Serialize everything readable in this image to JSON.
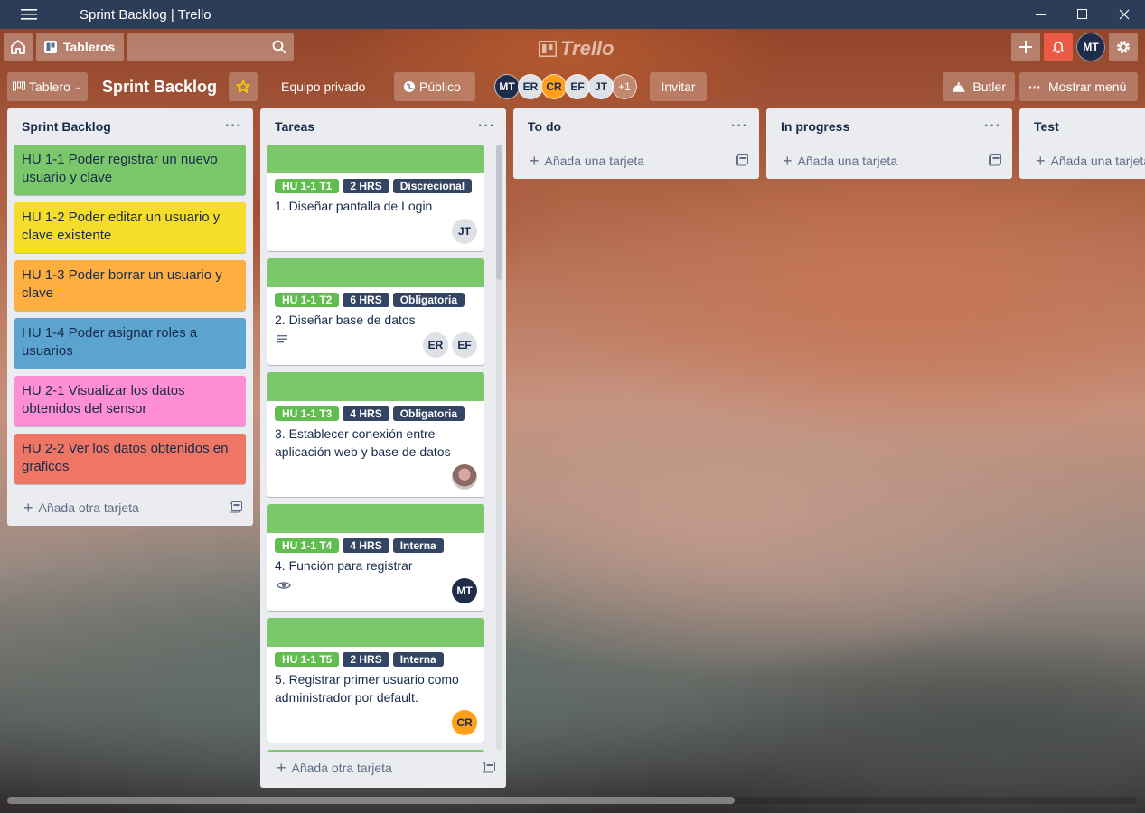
{
  "window": {
    "title": "Sprint Backlog | Trello"
  },
  "header": {
    "boards_label": "Tableros",
    "logo_text": "Trello",
    "user_initials": "MT"
  },
  "board": {
    "view_label": "Tablero",
    "title": "Sprint Backlog",
    "team_label": "Equipo privado",
    "visibility_label": "Público",
    "members": [
      "MT",
      "ER",
      "CR",
      "EF",
      "JT"
    ],
    "members_more": "+1",
    "invite_label": "Invitar",
    "butler_label": "Butler",
    "menu_label": "Mostrar menú"
  },
  "lists": [
    {
      "name": "Sprint Backlog",
      "add_label": "Añada otra tarjeta",
      "cards": [
        {
          "title": "HU 1-1 Poder registrar un nuevo usuario y clave",
          "color": "#7bc86c"
        },
        {
          "title": "HU 1-2 Poder editar un usuario y clave existente",
          "color": "#f5dd29"
        },
        {
          "title": "HU 1-3 Poder borrar un usuario y clave",
          "color": "#ffaf3f"
        },
        {
          "title": "HU 1-4 Poder asignar roles a usuarios",
          "color": "#5ba4cf"
        },
        {
          "title": "HU 2-1 Visualizar los datos obtenidos del sensor",
          "color": "#ff8ed4"
        },
        {
          "title": "HU 2-2 Ver los datos obtenidos en graficos",
          "color": "#ef7564"
        }
      ]
    },
    {
      "name": "Tareas",
      "add_label": "Añada otra tarjeta",
      "cards": [
        {
          "labels": [
            "HU 1-1 T1",
            "2 HRS",
            "Discrecional"
          ],
          "title": "1. Diseñar pantalla de Login",
          "members": [
            "JT"
          ]
        },
        {
          "labels": [
            "HU 1-1 T2",
            "6 HRS",
            "Obligatoria"
          ],
          "title": "2. Diseñar base de datos",
          "members": [
            "ER",
            "EF"
          ],
          "badge": "description-icon"
        },
        {
          "labels": [
            "HU 1-1 T3",
            "4 HRS",
            "Obligatoria"
          ],
          "title": "3. Establecer conexión entre aplicación web y base de datos",
          "members": [
            "photo"
          ]
        },
        {
          "labels": [
            "HU 1-1 T4",
            "4 HRS",
            "Interna"
          ],
          "title": "4. Función para registrar",
          "members": [
            "MT"
          ],
          "badge": "eye-icon"
        },
        {
          "labels": [
            "HU 1-1 T5",
            "2 HRS",
            "Interna"
          ],
          "title": "5. Registrar primer usuario como administrador por default.",
          "members": [
            "CR"
          ]
        }
      ]
    },
    {
      "name": "To do",
      "add_label": "Añada una tarjeta"
    },
    {
      "name": "In progress",
      "add_label": "Añada una tarjeta"
    },
    {
      "name": "Test",
      "add_label": "Añada una tarjeta"
    }
  ],
  "colors": {
    "titlebar": "#2c3d5a",
    "green_label": "#61bd4f",
    "dark_label": "#344563",
    "notif": "#eb5a46"
  }
}
